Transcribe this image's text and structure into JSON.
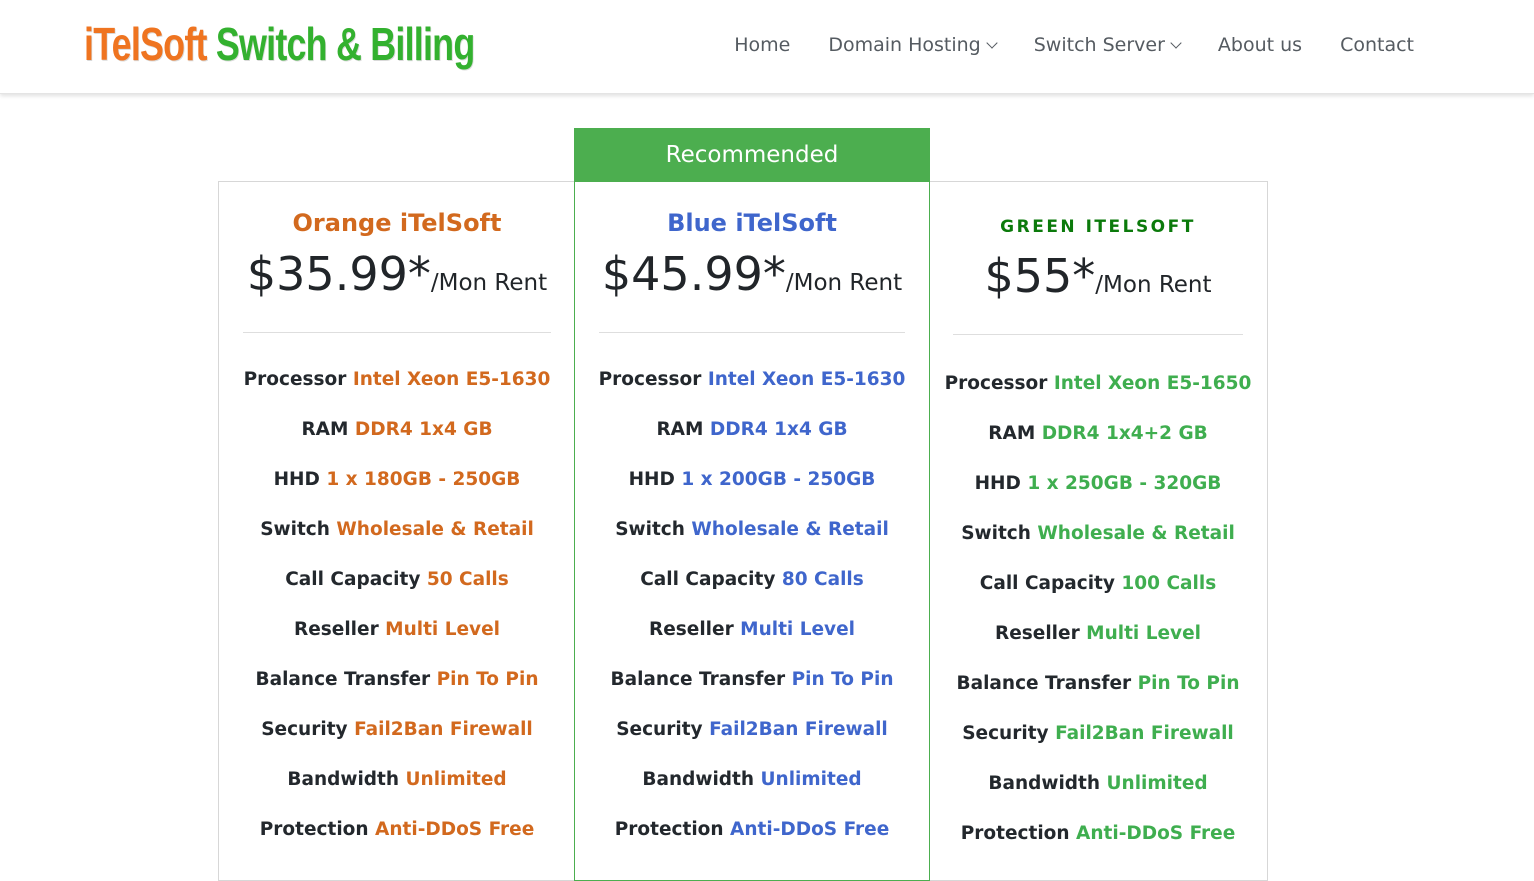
{
  "header": {
    "logo_part1": "iTelSoft",
    "logo_part2": " Switch & Billing",
    "nav": [
      {
        "label": "Home"
      },
      {
        "label": "Domain Hosting",
        "has_dropdown": true
      },
      {
        "label": "Switch Server",
        "has_dropdown": true
      },
      {
        "label": "About us"
      },
      {
        "label": "Contact"
      }
    ]
  },
  "colors": {
    "orange": "#d2691e",
    "blue": "#3f66cc",
    "green": "#3fae4f",
    "recommended_bg": "#4cae4f",
    "logo_orange": "#ef7420",
    "logo_green": "#33b12f"
  },
  "recommended_label": "Recommended",
  "plans": [
    {
      "name": "Orange iTelSoft",
      "price": "$35.99*",
      "unit": "/Mon Rent",
      "features": [
        {
          "label": "Processor",
          "value": "Intel Xeon E5-1630"
        },
        {
          "label": "RAM",
          "value": "DDR4 1x4 GB"
        },
        {
          "label": "HHD",
          "value": "1 x 180GB - 250GB"
        },
        {
          "label": "Switch",
          "value": "Wholesale & Retail"
        },
        {
          "label": "Call Capacity",
          "value": "50 Calls"
        },
        {
          "label": "Reseller",
          "value": "Multi Level"
        },
        {
          "label": "Balance Transfer",
          "value": "Pin To Pin"
        },
        {
          "label": "Security",
          "value": "Fail2Ban Firewall"
        },
        {
          "label": "Bandwidth",
          "value": "Unlimited"
        },
        {
          "label": "Protection",
          "value": "Anti-DDoS Free"
        }
      ]
    },
    {
      "name": "Blue iTelSoft",
      "price": "$45.99*",
      "unit": "/Mon Rent",
      "features": [
        {
          "label": "Processor",
          "value": "Intel Xeon E5-1630"
        },
        {
          "label": "RAM",
          "value": "DDR4 1x4 GB"
        },
        {
          "label": "HHD",
          "value": "1 x 200GB - 250GB"
        },
        {
          "label": "Switch",
          "value": "Wholesale & Retail"
        },
        {
          "label": "Call Capacity",
          "value": "80 Calls"
        },
        {
          "label": "Reseller",
          "value": "Multi Level"
        },
        {
          "label": "Balance Transfer",
          "value": "Pin To Pin"
        },
        {
          "label": "Security",
          "value": "Fail2Ban Firewall"
        },
        {
          "label": "Bandwidth",
          "value": "Unlimited"
        },
        {
          "label": "Protection",
          "value": "Anti-DDoS Free"
        }
      ]
    },
    {
      "name": "Green iTelSoft",
      "price": "$55*",
      "unit": "/Mon Rent",
      "features": [
        {
          "label": "Processor",
          "value": "Intel Xeon E5-1650"
        },
        {
          "label": "RAM",
          "value": "DDR4 1x4+2 GB"
        },
        {
          "label": "HHD",
          "value": "1 x 250GB - 320GB"
        },
        {
          "label": "Switch",
          "value": "Wholesale & Retail"
        },
        {
          "label": "Call Capacity",
          "value": "100 Calls"
        },
        {
          "label": "Reseller",
          "value": "Multi Level"
        },
        {
          "label": "Balance Transfer",
          "value": "Pin To Pin"
        },
        {
          "label": "Security",
          "value": "Fail2Ban Firewall"
        },
        {
          "label": "Bandwidth",
          "value": "Unlimited"
        },
        {
          "label": "Protection",
          "value": "Anti-DDoS Free"
        }
      ]
    }
  ]
}
